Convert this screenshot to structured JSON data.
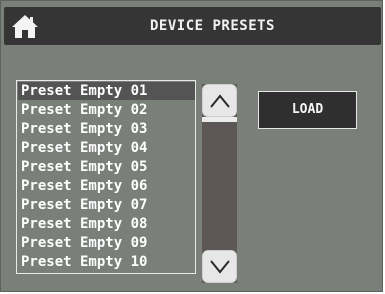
{
  "header": {
    "title": "DEVICE PRESETS",
    "home_icon": "home-icon"
  },
  "presets": [
    {
      "label": "Preset Empty 01",
      "selected": true
    },
    {
      "label": "Preset Empty 02",
      "selected": false
    },
    {
      "label": "Preset Empty 03",
      "selected": false
    },
    {
      "label": "Preset Empty 04",
      "selected": false
    },
    {
      "label": "Preset Empty 05",
      "selected": false
    },
    {
      "label": "Preset Empty 06",
      "selected": false
    },
    {
      "label": "Preset Empty 07",
      "selected": false
    },
    {
      "label": "Preset Empty 08",
      "selected": false
    },
    {
      "label": "Preset Empty 09",
      "selected": false
    },
    {
      "label": "Preset Empty 10",
      "selected": false
    }
  ],
  "scrollbar": {
    "up_icon": "chevron-up-icon",
    "down_icon": "chevron-down-icon",
    "position": 0
  },
  "actions": {
    "load_label": "LOAD"
  },
  "colors": {
    "panel_bg": "#7a7f7a",
    "header_bg": "#353535",
    "selected_bg": "#545454",
    "track_bg": "#5d5757",
    "button_dark": "#2f2f2f"
  }
}
